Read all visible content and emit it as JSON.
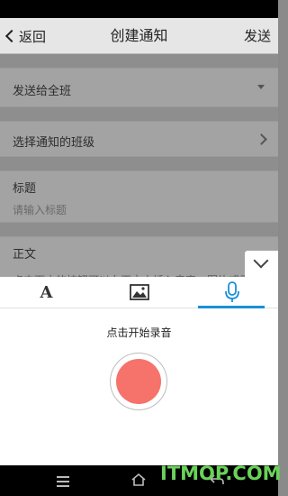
{
  "nav": {
    "back_label": "返回",
    "title": "创建通知",
    "send_label": "发送"
  },
  "form": {
    "recipients_label": "发送给全班",
    "class_select_label": "选择通知的班级",
    "title_label": "标题",
    "title_placeholder": "请输入标题",
    "body_label": "正文",
    "body_text": "点击下方的按钮可以向正文中插入音字，图片或录"
  },
  "toolbar": {
    "tabs": [
      "font-icon",
      "image-icon",
      "microphone-icon"
    ],
    "active_tab": "microphone-icon"
  },
  "recorder": {
    "hint": "点击开始录音"
  },
  "watermark": "ITMOP.COM",
  "colors": {
    "accent": "#1a8fd6",
    "record": "#f5736a",
    "watermark": "#6ad15a"
  }
}
